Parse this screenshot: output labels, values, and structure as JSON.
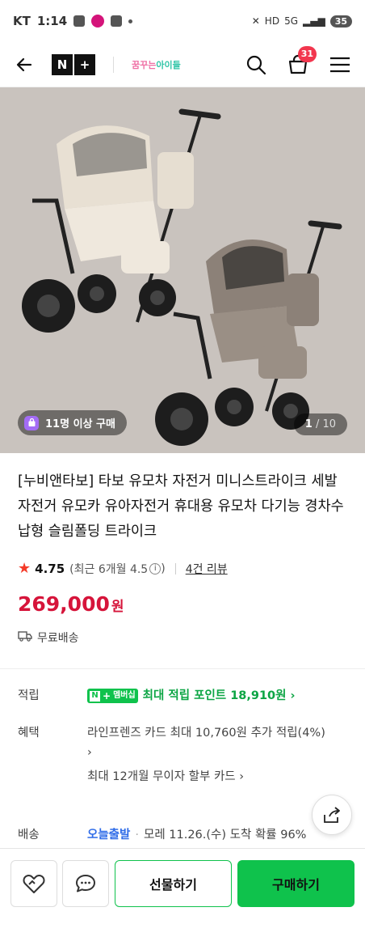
{
  "status_bar": {
    "carrier": "KT",
    "time": "1:14",
    "battery": "35",
    "net": "5G"
  },
  "header": {
    "logo_n": "N",
    "logo_plus": "+",
    "store_name_pink": "꿈꾸는",
    "store_name": "아이들",
    "cart_count": "31"
  },
  "hero": {
    "buyers_badge": "11명 이상 구매",
    "pager_current": "1",
    "pager_total": "/ 10"
  },
  "product": {
    "title": "[누비앤타보] 타보 유모차 자전거 미니스트라이크 세발자전거 유모카 유아자전거 휴대용 유모차 다기능 경차수납형 슬림폴딩 트라이크",
    "rating": "4.75",
    "rating_detail": "(최근 6개월 4.5",
    "rating_close": ")",
    "review_count": "4건 리뷰",
    "price": "269,000",
    "currency": "원",
    "shipping": "무료배송"
  },
  "details": {
    "points_label": "적립",
    "membership_badge": "멤버십",
    "points_text": "최대 적립 포인트 18,910원",
    "benefit_label": "혜택",
    "benefit_1": "라인프렌즈 카드 최대 10,760원 추가 적립(4%)",
    "benefit_2": "최대 12개월 무이자 할부 카드",
    "delivery_label": "배송",
    "delivery_type": "오늘출발",
    "delivery_text": "모레 11.26.(수) 도착 확률 96%"
  },
  "bottom": {
    "gift_label": "선물하기",
    "buy_label": "구매하기"
  },
  "colors": {
    "accent_green": "#0fc24c",
    "price_red": "#d6143a",
    "star_red": "#f43b29",
    "link_blue": "#2f6ce8"
  },
  "icons": [
    "back-arrow-icon",
    "search-icon",
    "cart-icon",
    "menu-icon",
    "bag-icon",
    "truck-icon",
    "share-icon",
    "wishlist-heart-icon",
    "chat-icon"
  ]
}
